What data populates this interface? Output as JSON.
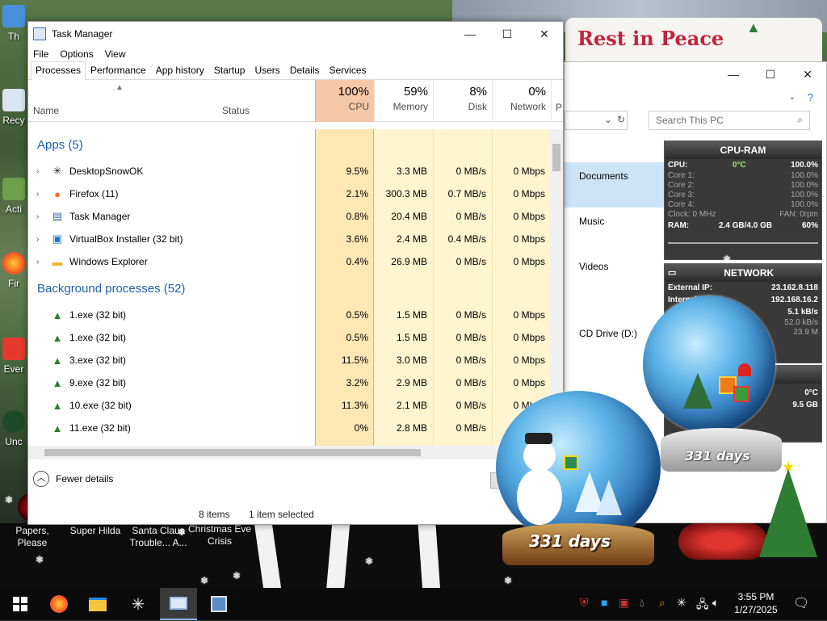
{
  "desktop": {
    "sign_text": "Rest in Peace",
    "icons": [
      {
        "label": "Th",
        "name": "this-pc"
      },
      {
        "label": "Recy",
        "name": "recycle-bin"
      },
      {
        "label": "Acti",
        "name": "activate"
      },
      {
        "label": "Fir",
        "name": "firefox"
      },
      {
        "label": "Ever",
        "name": "everything"
      },
      {
        "label": "Unc",
        "name": "uncharted"
      },
      {
        "label": "Papers, Please",
        "name": "papers-please"
      },
      {
        "label": "Super Hilda",
        "name": "super-hilda"
      },
      {
        "label": "Santa Claus Trouble... A...",
        "name": "santa-claus-trouble"
      },
      {
        "label": "Christmas Eve Crisis",
        "name": "christmas-eve-crisis"
      }
    ]
  },
  "taskmgr": {
    "title": "Task Manager",
    "menu": [
      "File",
      "Options",
      "View"
    ],
    "tabs": [
      "Processes",
      "Performance",
      "App history",
      "Startup",
      "Users",
      "Details",
      "Services"
    ],
    "columns": {
      "name": "Name",
      "status": "Status",
      "cpu_pct": "100%",
      "cpu_label": "CPU",
      "mem_pct": "59%",
      "mem_label": "Memory",
      "disk_pct": "8%",
      "disk_label": "Disk",
      "net_pct": "0%",
      "net_label": "Network",
      "power_label": "P"
    },
    "apps_group": "Apps (5)",
    "apps": [
      {
        "name": "DesktopSnowOK",
        "cpu": "9.5%",
        "mem": "3.3 MB",
        "disk": "0 MB/s",
        "net": "0 Mbps",
        "icon": "snowflake-icon"
      },
      {
        "name": "Firefox (11)",
        "cpu": "2.1%",
        "mem": "300.3 MB",
        "disk": "0.7 MB/s",
        "net": "0 Mbps",
        "icon": "firefox-icon"
      },
      {
        "name": "Task Manager",
        "cpu": "0.8%",
        "mem": "20.4 MB",
        "disk": "0 MB/s",
        "net": "0 Mbps",
        "icon": "task-manager-icon"
      },
      {
        "name": "VirtualBox Installer (32 bit)",
        "cpu": "3.6%",
        "mem": "2.4 MB",
        "disk": "0.4 MB/s",
        "net": "0 Mbps",
        "icon": "virtualbox-icon"
      },
      {
        "name": "Windows Explorer",
        "cpu": "0.4%",
        "mem": "26.9 MB",
        "disk": "0 MB/s",
        "net": "0 Mbps",
        "icon": "folder-icon"
      }
    ],
    "bg_group": "Background processes (52)",
    "bg": [
      {
        "name": "1.exe (32 bit)",
        "cpu": "0.5%",
        "mem": "1.5 MB",
        "disk": "0 MB/s",
        "net": "0 Mbps",
        "icon": "tree-icon"
      },
      {
        "name": "1.exe (32 bit)",
        "cpu": "0.5%",
        "mem": "1.5 MB",
        "disk": "0 MB/s",
        "net": "0 Mbps",
        "icon": "tree-icon"
      },
      {
        "name": "3.exe (32 bit)",
        "cpu": "11.5%",
        "mem": "3.0 MB",
        "disk": "0 MB/s",
        "net": "0 Mbps",
        "icon": "tree-icon"
      },
      {
        "name": "9.exe (32 bit)",
        "cpu": "3.2%",
        "mem": "2.9 MB",
        "disk": "0 MB/s",
        "net": "0 Mbps",
        "icon": "tree-icon"
      },
      {
        "name": "10.exe (32 bit)",
        "cpu": "11.3%",
        "mem": "2.1 MB",
        "disk": "0 MB/s",
        "net": "0 Mbps",
        "icon": "tree-icon"
      },
      {
        "name": "11.exe (32 bit)",
        "cpu": "0%",
        "mem": "2.8 MB",
        "disk": "0 MB/s",
        "net": "0 Mbps",
        "icon": "tree-icon"
      }
    ],
    "fewer_details": "Fewer details"
  },
  "explorer": {
    "search_placeholder": "Search This PC",
    "nav": [
      "Documents",
      "Music",
      "Videos",
      "CD Drive (D:)"
    ],
    "status_items": "8 items",
    "status_selected": "1 item selected"
  },
  "cpu_ram": {
    "title": "CPU-RAM",
    "cpu_label": "CPU:",
    "cpu_temp": "0°C",
    "cpu_pct": "100.0%",
    "cores": [
      {
        "label": "Core 1:",
        "value": "100.0%"
      },
      {
        "label": "Core 2:",
        "value": "100.0%"
      },
      {
        "label": "Core 3:",
        "value": "100.0%"
      },
      {
        "label": "Core 4:",
        "value": "100.0%"
      }
    ],
    "clock": "Clock: 0 MHz",
    "fan": "FAN: 0rpm",
    "ram_label": "RAM:",
    "ram_val": "2.4 GB/4.0 GB",
    "ram_pct": "60%"
  },
  "network": {
    "title": "NETWORK",
    "ext_label": "External IP:",
    "ext_val": "23.162.8.118",
    "int_label": "Internal",
    "int_val": "192.168.16.2",
    "up": "5.1 kB/s",
    "down": "52.0 kB/s",
    "total": "23.9 M"
  },
  "temp_gadget": {
    "temp": "0°C",
    "mem": "9.5 GB"
  },
  "globes": {
    "days_a": "331 days",
    "days_b": "331 days"
  },
  "clock": {
    "time": "3:55 PM",
    "date": "1/27/2025"
  }
}
